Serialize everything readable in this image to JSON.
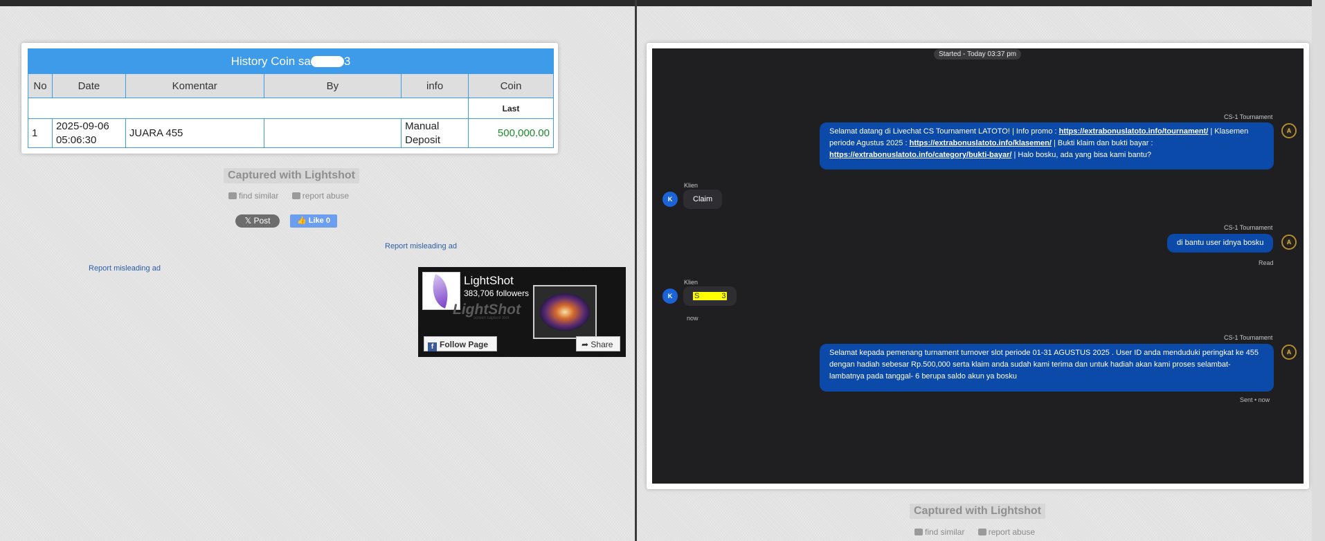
{
  "left_shot": {
    "table_title": "History Coin sa",
    "table_title_suffix": "3",
    "columns": [
      "No",
      "Date",
      "Komentar",
      "By",
      "info",
      "Coin"
    ],
    "last_label": "Last",
    "row": {
      "no": "1",
      "date_line1": "2025-09-06",
      "date_line2": "05:06:30",
      "komentar": "JUARA 455",
      "by": "",
      "info_line1": "Manual",
      "info_line2": "Deposit",
      "coin": "500,000.00"
    }
  },
  "lightshot_left": {
    "captured": "Captured with Lightshot",
    "find_similar": "find similar",
    "report_abuse": "report abuse",
    "post_label": "𝕏 Post",
    "like_label": "👍 Like 0"
  },
  "ads": {
    "report_ad_1": "Report misleading ad",
    "report_ad_2": "Report misleading ad"
  },
  "fb_box": {
    "page_name": "LightShot",
    "followers": "383,706 followers",
    "brand": "LightShot",
    "brand_sub": "screen capture tool",
    "follow_label": "Follow Page",
    "share_label": "Share"
  },
  "chat": {
    "started": "Started - Today 03:37 pm",
    "agent_name": "CS-1 Tournament",
    "client_name": "Klien",
    "agent_avatar": "A",
    "client_avatar": "K",
    "messages": [
      {
        "p1": "Selamat datang di Livechat CS Tournament LATOTO! | Info promo : ",
        "link1": "https://extrabonuslatoto.info/tournament/",
        "p2": " | Klasemen periode Agustus 2025 : ",
        "link2": "https://extrabonuslatoto.info/klasemen/",
        "p3": " | Bukti klaim dan bukti bayar : ",
        "link3": "https://extrabonuslatoto.info/category/bukti-bayar/",
        "p4": " | Halo bosku, ada yang bisa kami bantu?"
      },
      {
        "text": "Claim"
      },
      {
        "text": "di bantu user idnya bosku",
        "status": "Read"
      },
      {
        "text_start": "S",
        "text_end": "3",
        "status": "now"
      },
      {
        "text": "Selamat kepada pemenang turnament turnover slot periode 01-31 AGUSTUS 2025 . User ID anda menduduki peringkat ke 455 dengan hadiah sebesar Rp.500,000 serta klaim anda sudah kami terima dan untuk hadiah akan kami proses selambat-lambatnya pada tanggal- 6 berupa saldo akun ya bosku",
        "status": "Sent • now"
      }
    ]
  },
  "lightshot_right": {
    "captured": "Captured with Lightshot",
    "find_similar": "find similar",
    "report_abuse": "report abuse"
  }
}
